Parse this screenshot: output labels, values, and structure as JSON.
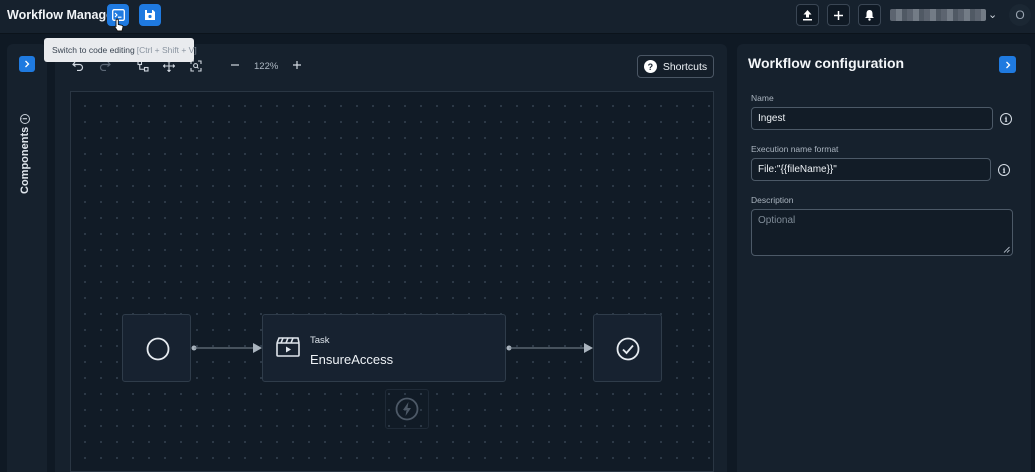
{
  "app": {
    "title": "Workflow Manager"
  },
  "toolbar": {
    "code_edit_icon": "terminal-icon",
    "save_icon": "floppy-disk-icon",
    "upload_icon": "upload-icon",
    "add_icon": "plus-icon",
    "notifications_icon": "bell-icon",
    "avatar_initial": "O",
    "user_caret": "⌄"
  },
  "tooltip": {
    "text": "Switch to code editing",
    "shortcut": "[Ctrl + Shift + V]"
  },
  "components_rail": {
    "label": "Components",
    "info_glyph": "i"
  },
  "canvas": {
    "zoom": "122%",
    "shortcuts_label": "Shortcuts",
    "shortcuts_glyph": "?",
    "nodes": [
      {
        "kind": "start",
        "icon": "circle-icon"
      },
      {
        "kind": "task",
        "type_label": "Task",
        "name": "EnsureAccess",
        "icon": "clapperboard-icon"
      },
      {
        "kind": "end",
        "icon": "check-circle-icon"
      }
    ],
    "trigger_icon": "lightning-icon"
  },
  "config": {
    "title": "Workflow configuration",
    "name_label": "Name",
    "name_value": "Ingest",
    "exec_label": "Execution name format",
    "exec_value": "File:\"{{fileName}}\"",
    "desc_label": "Description",
    "desc_placeholder": "Optional",
    "info_glyph": "i"
  },
  "colors": {
    "accent": "#1f7ae0",
    "background": "#0f1924",
    "panel": "#16212d"
  }
}
